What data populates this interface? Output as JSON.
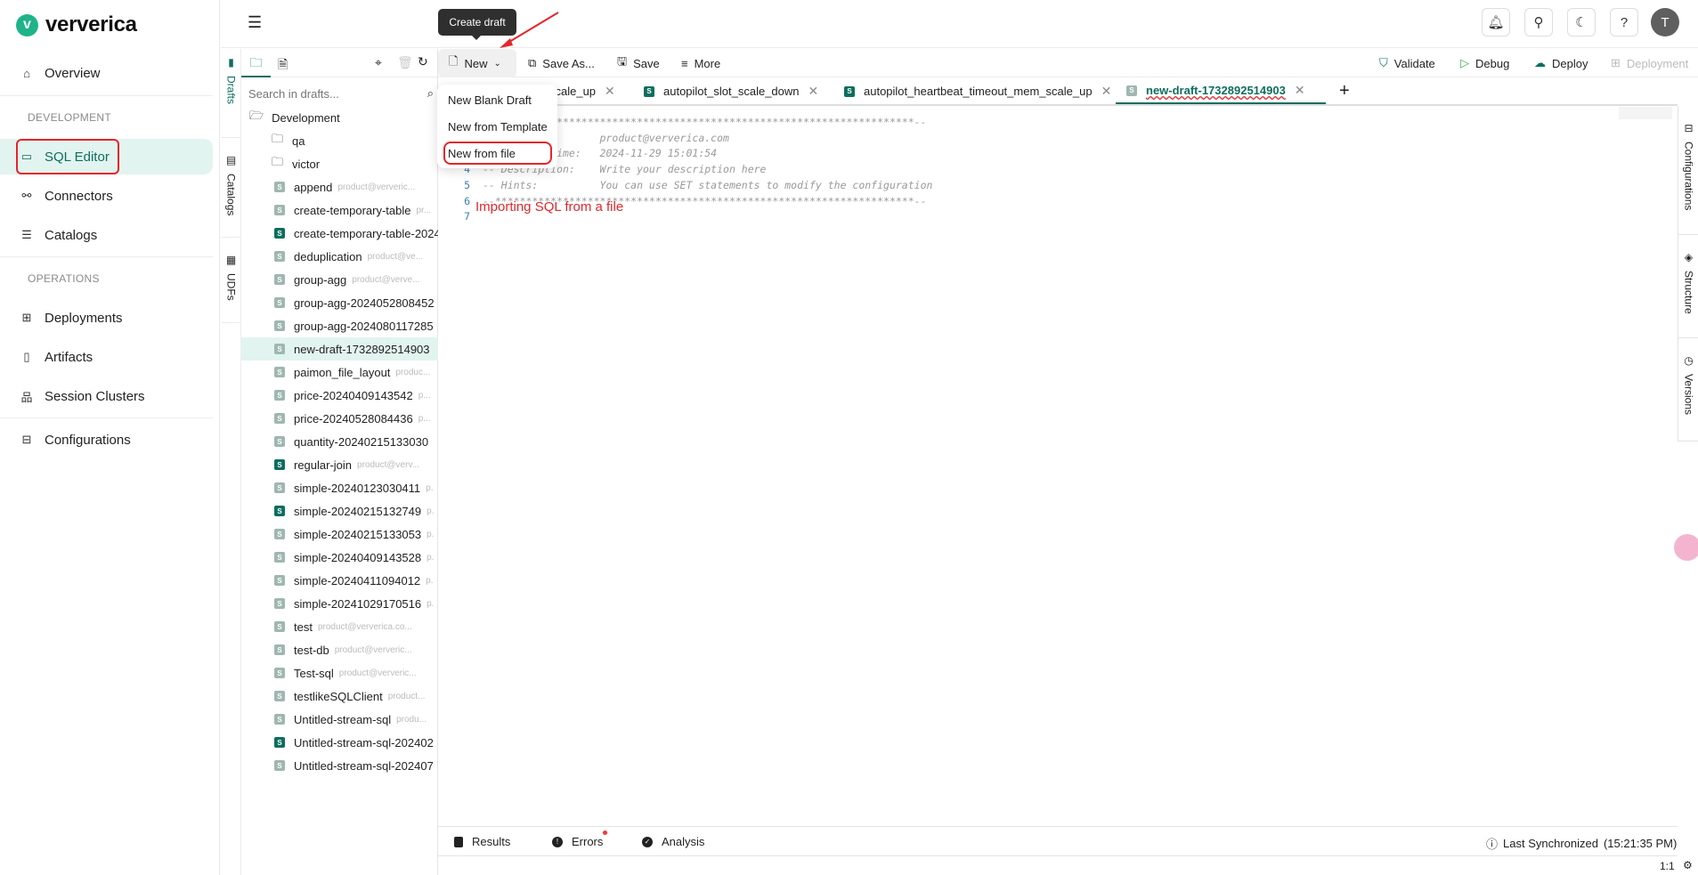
{
  "brand": {
    "name": "ververica"
  },
  "sidebar": {
    "items": [
      {
        "label": "Overview",
        "icon": "home-icon"
      },
      {
        "label": "SQL Editor",
        "icon": "sql-monitor-icon"
      },
      {
        "label": "Connectors",
        "icon": "connectors-icon"
      },
      {
        "label": "Catalogs",
        "icon": "catalogs-icon"
      },
      {
        "label": "Deployments",
        "icon": "deployments-icon"
      },
      {
        "label": "Artifacts",
        "icon": "artifacts-icon"
      },
      {
        "label": "Session Clusters",
        "icon": "session-clusters-icon"
      },
      {
        "label": "Configurations",
        "icon": "configurations-icon"
      }
    ],
    "sections": [
      "DEVELOPMENT",
      "OPERATIONS"
    ],
    "active": "SQL Editor"
  },
  "header": {
    "avatar": "T"
  },
  "vertical_tabs": [
    {
      "label": "Drafts"
    },
    {
      "label": "Catalogs"
    },
    {
      "label": "UDFs"
    }
  ],
  "drafts": {
    "search_placeholder": "Search in drafts...",
    "root": "Development",
    "folders": [
      "qa",
      "victor"
    ],
    "files": [
      {
        "name": "append",
        "owner": "product@ververic...",
        "dark": false
      },
      {
        "name": "create-temporary-table",
        "owner": "pr...",
        "dark": false
      },
      {
        "name": "create-temporary-table-2024",
        "owner": "",
        "dark": true
      },
      {
        "name": "deduplication",
        "owner": "product@ve...",
        "dark": false
      },
      {
        "name": "group-agg",
        "owner": "product@verve...",
        "dark": false
      },
      {
        "name": "group-agg-2024052808452",
        "owner": "",
        "dark": false
      },
      {
        "name": "group-agg-2024080117285",
        "owner": "",
        "dark": false
      },
      {
        "name": "new-draft-1732892514903",
        "owner": "",
        "dark": false,
        "selected": true
      },
      {
        "name": "paimon_file_layout",
        "owner": "produc...",
        "dark": false
      },
      {
        "name": "price-20240409143542",
        "owner": "p...",
        "dark": false
      },
      {
        "name": "price-20240528084436",
        "owner": "p...",
        "dark": false
      },
      {
        "name": "quantity-20240215133030",
        "owner": "",
        "dark": false
      },
      {
        "name": "regular-join",
        "owner": "product@verv...",
        "dark": true
      },
      {
        "name": "simple-20240123030411",
        "owner": "p.",
        "dark": false
      },
      {
        "name": "simple-20240215132749",
        "owner": "p.",
        "dark": true
      },
      {
        "name": "simple-20240215133053",
        "owner": "p.",
        "dark": false
      },
      {
        "name": "simple-20240409143528",
        "owner": "p.",
        "dark": false
      },
      {
        "name": "simple-20240411094012",
        "owner": "p.",
        "dark": false
      },
      {
        "name": "simple-20241029170516",
        "owner": "p.",
        "dark": false
      },
      {
        "name": "test",
        "owner": "product@ververica.co...",
        "dark": false
      },
      {
        "name": "test-db",
        "owner": "product@ververic...",
        "dark": false
      },
      {
        "name": "Test-sql",
        "owner": "product@ververic...",
        "dark": false
      },
      {
        "name": "testlikeSQLClient",
        "owner": "product...",
        "dark": false
      },
      {
        "name": "Untitled-stream-sql",
        "owner": "produ...",
        "dark": false
      },
      {
        "name": "Untitled-stream-sql-202402",
        "owner": "",
        "dark": true
      },
      {
        "name": "Untitled-stream-sql-202407",
        "owner": "",
        "dark": false
      }
    ]
  },
  "toolbar": {
    "new": "New",
    "save_as": "Save As...",
    "save": "Save",
    "more": "More",
    "validate": "Validate",
    "debug": "Debug",
    "deploy": "Deploy",
    "deployment": "Deployment"
  },
  "tooltip": "Create draft",
  "new_menu": [
    "New Blank Draft",
    "New from Template",
    "New from file"
  ],
  "tabs": [
    {
      "label": "scale_up"
    },
    {
      "label": "autopilot_slot_scale_down"
    },
    {
      "label": "autopilot_heartbeat_timeout_mem_scale_up"
    },
    {
      "label": "new-draft-1732892514903",
      "active": true
    }
  ],
  "editor": {
    "lines": [
      {
        "n": "1",
        "text": "--********************************************************************--"
      },
      {
        "n": "2",
        "text": "-- Author:         product@ververica.com"
      },
      {
        "n": "3",
        "text": "-- Created Time:   2024-11-29 15:01:54"
      },
      {
        "n": "4",
        "text": "-- Description:    Write your description here"
      },
      {
        "n": "5",
        "text": "-- Hints:          You can use SET statements to modify the configuration"
      },
      {
        "n": "6",
        "text": "--********************************************************************--"
      },
      {
        "n": "7",
        "text": ""
      }
    ],
    "annotation": "Importing SQL from a file",
    "annotation_color": "#e3262a"
  },
  "right_tabs": [
    {
      "label": "Configurations"
    },
    {
      "label": "Structure"
    },
    {
      "label": "Versions"
    }
  ],
  "bottom": {
    "results": "Results",
    "errors": "Errors",
    "analysis": "Analysis",
    "sync": "Last Synchronized",
    "sync_time": "(15:21:35 PM)"
  },
  "status": {
    "zoom": "1:1"
  },
  "colors": {
    "accent": "#0d6e5e",
    "highlight": "#e2f4ef",
    "annotation": "#e3262a"
  }
}
